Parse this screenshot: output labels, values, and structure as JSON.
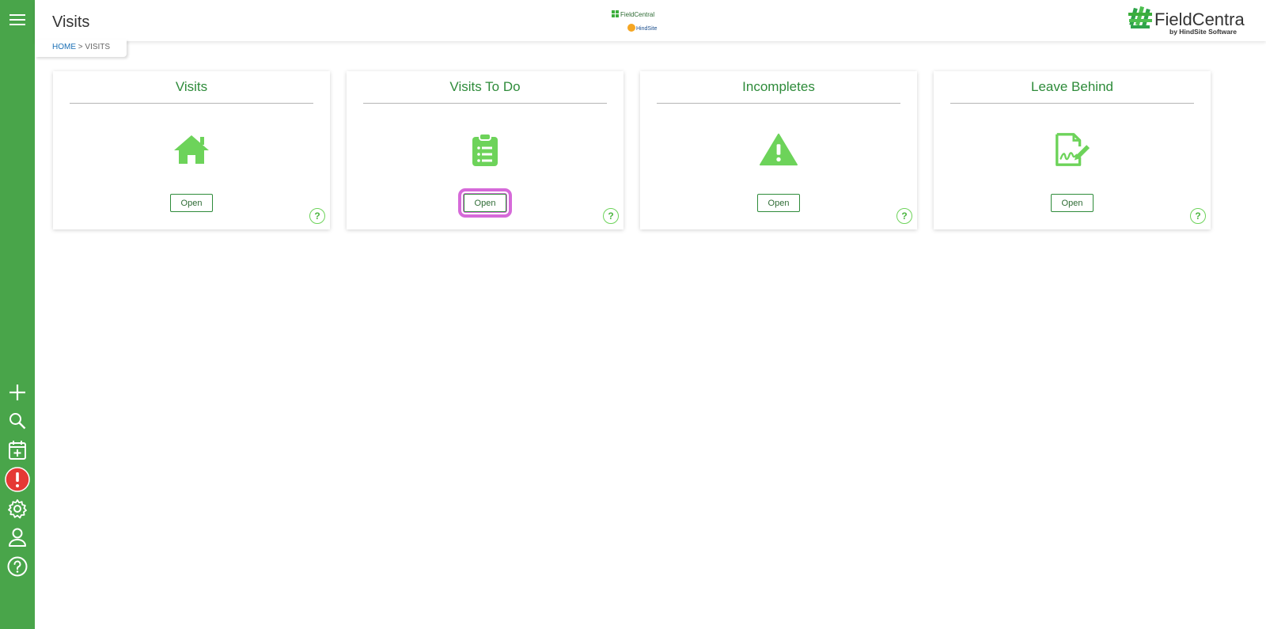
{
  "header": {
    "title": "Visits",
    "center_logo": {
      "line1": "FieldCentral",
      "line2": "HindSite"
    },
    "brand_logo": {
      "name": "FieldCentral",
      "tagline": "by HindSite Software"
    }
  },
  "breadcrumb": {
    "home": "HOME",
    "separator": " > ",
    "current": "VISITS"
  },
  "sidebar": {
    "menu_icon": "hamburger-menu-icon",
    "items": [
      {
        "icon": "plus-icon"
      },
      {
        "icon": "search-icon"
      },
      {
        "icon": "calendar-add-icon"
      },
      {
        "icon": "alert-icon"
      },
      {
        "icon": "gear-icon"
      },
      {
        "icon": "user-icon"
      },
      {
        "icon": "help-icon"
      }
    ]
  },
  "cards": [
    {
      "title": "Visits",
      "icon": "house-icon",
      "button": "Open",
      "help": "?"
    },
    {
      "title": "Visits To Do",
      "icon": "clipboard-list-icon",
      "button": "Open",
      "help": "?",
      "highlighted": true
    },
    {
      "title": "Incompletes",
      "icon": "warning-icon",
      "button": "Open",
      "help": "?"
    },
    {
      "title": "Leave Behind",
      "icon": "signed-document-icon",
      "button": "Open",
      "help": "?"
    }
  ],
  "colors": {
    "sidebar": "#49a54a",
    "card_title": "#2e8b3a",
    "icon_green": "#6dd35a",
    "alert_red": "#e53935",
    "highlight": "#d66ad9"
  }
}
